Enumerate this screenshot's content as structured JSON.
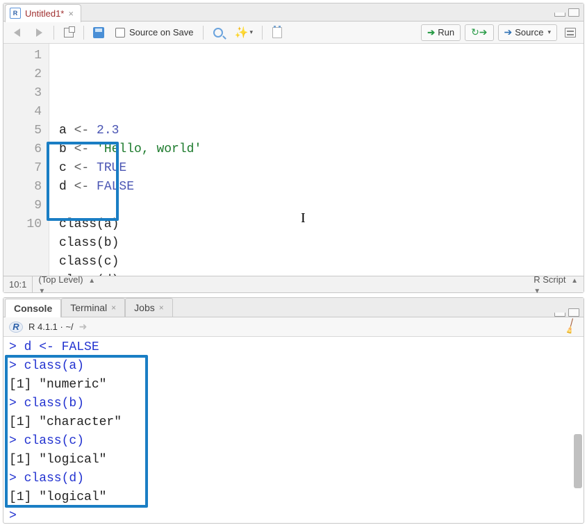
{
  "source": {
    "tab_filename": "Untitled1*",
    "toolbar": {
      "source_on_save": "Source on Save",
      "run": "Run",
      "source": "Source"
    },
    "code_lines": [
      {
        "n": 1,
        "html": "a <span class='tok-op'>&lt;-</span> <span class='tok-num'>2.3</span>"
      },
      {
        "n": 2,
        "html": "b <span class='tok-op'>&lt;-</span> <span class='tok-str'>'Hello, world'</span>"
      },
      {
        "n": 3,
        "html": "c <span class='tok-op'>&lt;-</span> <span class='tok-const'>TRUE</span>"
      },
      {
        "n": 4,
        "html": "d <span class='tok-op'>&lt;-</span> <span class='tok-const'>FALSE</span>"
      },
      {
        "n": 5,
        "html": ""
      },
      {
        "n": 6,
        "html": "class(a)"
      },
      {
        "n": 7,
        "html": "class(b)"
      },
      {
        "n": 8,
        "html": "class(c)"
      },
      {
        "n": 9,
        "html": "class(d)"
      },
      {
        "n": 10,
        "html": "<span class='cursor-line'></span>"
      }
    ],
    "status": {
      "pos": "10:1",
      "scope": "(Top Level)",
      "type": "R Script"
    }
  },
  "console": {
    "tabs": {
      "console": "Console",
      "terminal": "Terminal",
      "jobs": "Jobs"
    },
    "info": "R 4.1.1 · ~/",
    "lines": [
      {
        "cls": "cons-in",
        "text": "> d <- FALSE"
      },
      {
        "cls": "cons-in",
        "text": "> class(a)"
      },
      {
        "cls": "cons-out",
        "text": "[1] \"numeric\""
      },
      {
        "cls": "cons-in",
        "text": "> class(b)"
      },
      {
        "cls": "cons-out",
        "text": "[1] \"character\""
      },
      {
        "cls": "cons-in",
        "text": "> class(c)"
      },
      {
        "cls": "cons-out",
        "text": "[1] \"logical\""
      },
      {
        "cls": "cons-in",
        "text": "> class(d)"
      },
      {
        "cls": "cons-out",
        "text": "[1] \"logical\""
      },
      {
        "cls": "cons-in",
        "text": "> "
      }
    ]
  }
}
